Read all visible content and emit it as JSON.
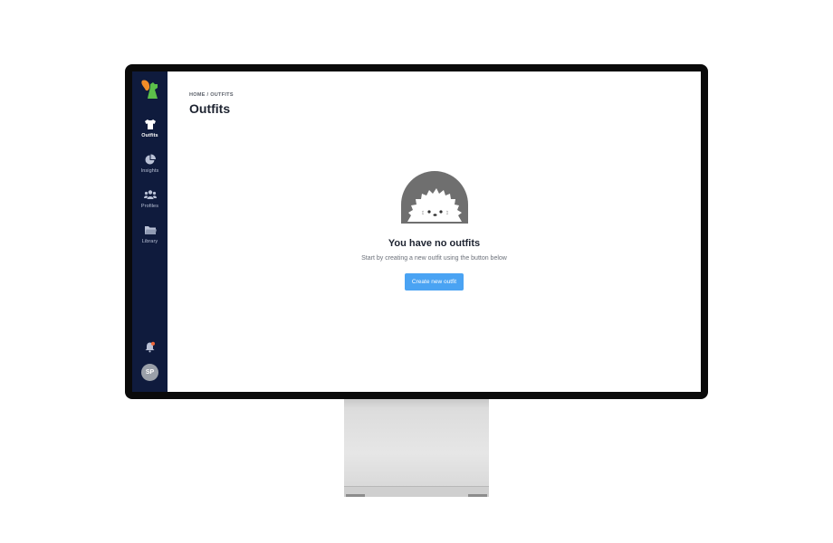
{
  "sidebar": {
    "items": [
      {
        "label": "Outfits",
        "icon": "shirt-icon",
        "active": true
      },
      {
        "label": "Insights",
        "icon": "pie-chart-icon",
        "active": false
      },
      {
        "label": "Profiles",
        "icon": "users-icon",
        "active": false
      },
      {
        "label": "Library",
        "icon": "folder-icon",
        "active": false
      }
    ],
    "avatar_initials": "SP",
    "notification_icon": "bell-icon"
  },
  "breadcrumb": {
    "home": "HOME",
    "separator": " / ",
    "current": "OUTFITS"
  },
  "page_title": "Outfits",
  "empty_state": {
    "title": "You have no outfits",
    "subtitle": "Start by creating a new outfit using the button below",
    "button_label": "Create new outfit"
  },
  "colors": {
    "sidebar_bg": "#0f1b3d",
    "accent": "#4aa3f3",
    "logo_orange": "#f28c28",
    "logo_green": "#5cc04a",
    "notification_dot": "#f2683a"
  }
}
